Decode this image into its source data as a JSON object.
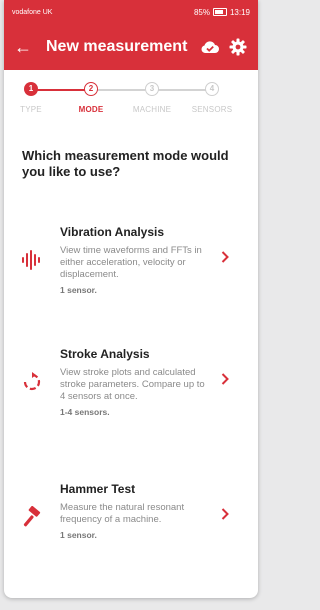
{
  "status_bar": {
    "carrier": "vodafone UK",
    "battery": "85%",
    "time": "13:19"
  },
  "app_bar": {
    "title": "New measurement",
    "back_icon": "back-arrow-icon",
    "cloud_icon": "cloud-check-icon",
    "settings_icon": "gear-icon"
  },
  "stepper": {
    "steps": [
      {
        "number": "1",
        "label": "TYPE"
      },
      {
        "number": "2",
        "label": "MODE"
      },
      {
        "number": "3",
        "label": "MACHINE"
      },
      {
        "number": "4",
        "label": "SENSORS"
      }
    ]
  },
  "question": "Which measurement mode would you like to use?",
  "modes": [
    {
      "title": "Vibration Analysis",
      "description": "View time waveforms and FFTs in either acceleration, velocity or displacement.",
      "sensors": "1 sensor.",
      "icon": "vibration-icon"
    },
    {
      "title": "Stroke Analysis",
      "description": "View stroke plots and calculated stroke parameters. Compare up to 4 sensors at once.",
      "sensors": "1-4 sensors.",
      "icon": "rotate-icon"
    },
    {
      "title": "Hammer Test",
      "description": "Measure the natural resonant frequency of a machine.",
      "sensors": "1 sensor.",
      "icon": "hammer-icon"
    }
  ],
  "colors": {
    "brand": "#d8303a",
    "inactive": "#c8c8c8"
  }
}
